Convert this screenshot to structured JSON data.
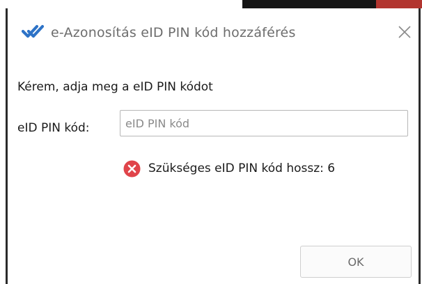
{
  "window": {
    "title": "e-Azonosítás eID PIN kód hozzáférés",
    "app_icon": "double-checkmark-icon",
    "close_icon": "close-icon"
  },
  "dialog": {
    "prompt": "Kérem, adja meg a eID PIN kódot",
    "pin_label": "eID PIN kód:",
    "pin_input": {
      "value": "",
      "placeholder": "eID PIN kód"
    },
    "error": {
      "icon": "error-circle-icon",
      "message": "Szükséges eID PIN kód hossz: 6"
    },
    "ok_label": "OK"
  },
  "colors": {
    "accent_blue": "#2e73c7",
    "error_red": "#e0444a"
  }
}
